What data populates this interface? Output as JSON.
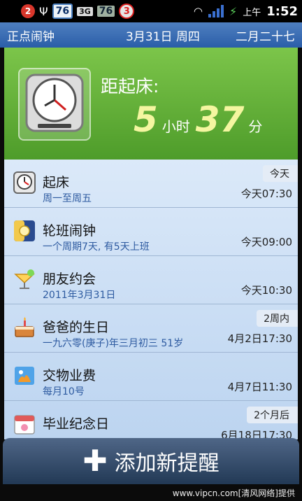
{
  "status_bar": {
    "notif_count": "2",
    "battery_level_1": "76",
    "network": "3G",
    "battery_level_2": "76",
    "alarm_badge": "3",
    "ampm": "上午",
    "time": "1:52"
  },
  "header": {
    "app_title": "正点闹钟",
    "date": "3月31日 周四",
    "lunar": "二月二十七"
  },
  "banner": {
    "label": "距起床:",
    "hours": "5",
    "hours_unit": "小时",
    "minutes": "37",
    "minutes_unit": "分"
  },
  "alarms": [
    {
      "title": "起床",
      "subtitle": "周一至周五",
      "time": "今天07:30",
      "tag": "今天",
      "icon": "alarm-clock-icon"
    },
    {
      "title": "轮班闹钟",
      "subtitle": "一个周期7天, 有5天上班",
      "time": "今天09:00",
      "tag": "",
      "icon": "day-night-icon"
    },
    {
      "title": "朋友约会",
      "subtitle": "2011年3月31日",
      "time": "今天10:30",
      "tag": "",
      "icon": "cocktail-icon"
    },
    {
      "title": "爸爸的生日",
      "subtitle": "一九六零(庚子)年三月初三 51岁",
      "time": "4月2日17:30",
      "tag": "2周内",
      "icon": "birthday-cake-icon"
    },
    {
      "title": "交物业费",
      "subtitle": "每月10号",
      "time": "4月7日11:30",
      "tag": "",
      "icon": "bill-icon"
    },
    {
      "title": "毕业纪念日",
      "subtitle": "",
      "time": "6月18日17:30",
      "tag": "2个月后",
      "icon": "calendar-icon"
    }
  ],
  "add_button": {
    "label": "添加新提醒"
  },
  "footer": {
    "watermark": "www.vipcn.com[清风网络]提供"
  }
}
